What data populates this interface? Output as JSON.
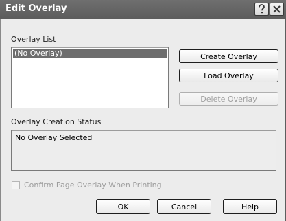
{
  "window": {
    "title": "Edit Overlay",
    "help_icon": "question-mark-icon",
    "close_icon": "close-icon"
  },
  "overlay_list": {
    "label": "Overlay List",
    "items": [
      "(No Overlay)"
    ],
    "selected_index": 0
  },
  "buttons": {
    "create": "Create Overlay",
    "load": "Load Overlay",
    "delete": "Delete Overlay",
    "delete_enabled": false
  },
  "status": {
    "label": "Overlay Creation Status",
    "text": "No Overlay Selected"
  },
  "confirm": {
    "label": "Confirm Page Overlay When Printing",
    "checked": false,
    "enabled": false
  },
  "footer": {
    "ok": "OK",
    "cancel": "Cancel",
    "help": "Help"
  },
  "colors": {
    "titlebar": "#5e5e5e",
    "selection": "#6d6d6d",
    "dialog_bg": "#ececec"
  }
}
